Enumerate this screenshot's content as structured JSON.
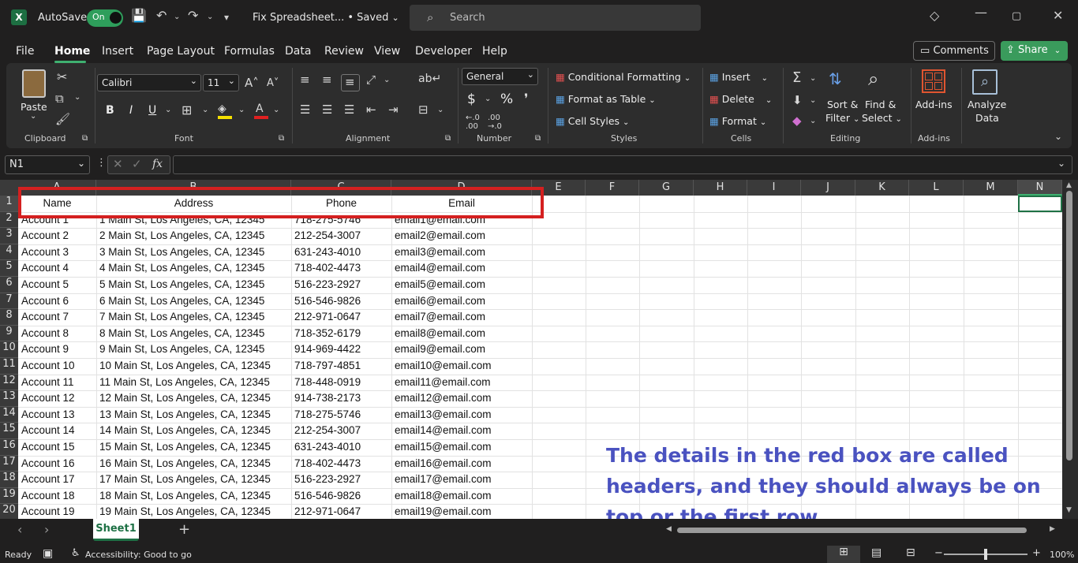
{
  "titlebar": {
    "app_icon": "X",
    "autosave_label": "AutoSave",
    "autosave_state": "On",
    "doc_title": "Fix Spreadsheet... • Saved",
    "search_placeholder": "Search"
  },
  "menu": {
    "tabs": [
      "File",
      "Home",
      "Insert",
      "Page Layout",
      "Formulas",
      "Data",
      "Review",
      "View",
      "Developer",
      "Help"
    ],
    "active": "Home",
    "comments_label": "Comments",
    "share_label": "Share"
  },
  "ribbon": {
    "clipboard": {
      "paste": "Paste",
      "label": "Clipboard"
    },
    "font": {
      "name": "Calibri",
      "size": "11",
      "label": "Font",
      "bold": "B",
      "italic": "I",
      "underline": "U"
    },
    "alignment": {
      "label": "Alignment"
    },
    "number": {
      "format": "General",
      "label": "Number",
      "currency": "$",
      "percent": "%"
    },
    "styles": {
      "conditional": "Conditional Formatting",
      "format_table": "Format as Table",
      "cell_styles": "Cell Styles",
      "label": "Styles"
    },
    "cells": {
      "insert": "Insert",
      "delete": "Delete",
      "format": "Format",
      "label": "Cells"
    },
    "editing": {
      "sort_filter_1": "Sort &",
      "sort_filter_2": "Filter",
      "find_select_1": "Find &",
      "find_select_2": "Select",
      "label": "Editing"
    },
    "addins": {
      "addins": "Add-ins",
      "label": "Add-ins"
    },
    "analyze": {
      "line1": "Analyze",
      "line2": "Data"
    }
  },
  "formula_bar": {
    "name_box": "N1",
    "fx": "fx",
    "value": ""
  },
  "sheet": {
    "columns": [
      "A",
      "B",
      "C",
      "D",
      "E",
      "F",
      "G",
      "H",
      "I",
      "J",
      "K",
      "L",
      "M",
      "N"
    ],
    "headers": [
      "Name",
      "Address",
      "Phone",
      "Email"
    ],
    "rows": [
      [
        "Account 1",
        "1 Main St, Los Angeles, CA, 12345",
        "718-275-5746",
        "email1@email.com"
      ],
      [
        "Account 2",
        "2 Main St, Los Angeles, CA, 12345",
        "212-254-3007",
        "email2@email.com"
      ],
      [
        "Account 3",
        "3 Main St, Los Angeles, CA, 12345",
        "631-243-4010",
        "email3@email.com"
      ],
      [
        "Account 4",
        "4 Main St, Los Angeles, CA, 12345",
        "718-402-4473",
        "email4@email.com"
      ],
      [
        "Account 5",
        "5 Main St, Los Angeles, CA, 12345",
        "516-223-2927",
        "email5@email.com"
      ],
      [
        "Account 6",
        "6 Main St, Los Angeles, CA, 12345",
        "516-546-9826",
        "email6@email.com"
      ],
      [
        "Account 7",
        "7 Main St, Los Angeles, CA, 12345",
        "212-971-0647",
        "email7@email.com"
      ],
      [
        "Account 8",
        "8 Main St, Los Angeles, CA, 12345",
        "718-352-6179",
        "email8@email.com"
      ],
      [
        "Account 9",
        "9 Main St, Los Angeles, CA, 12345",
        "914-969-4422",
        "email9@email.com"
      ],
      [
        "Account 10",
        "10 Main St, Los Angeles, CA, 12345",
        "718-797-4851",
        "email10@email.com"
      ],
      [
        "Account 11",
        "11 Main St, Los Angeles, CA, 12345",
        "718-448-0919",
        "email11@email.com"
      ],
      [
        "Account 12",
        "12 Main St, Los Angeles, CA, 12345",
        "914-738-2173",
        "email12@email.com"
      ],
      [
        "Account 13",
        "13 Main St, Los Angeles, CA, 12345",
        "718-275-5746",
        "email13@email.com"
      ],
      [
        "Account 14",
        "14 Main St, Los Angeles, CA, 12345",
        "212-254-3007",
        "email14@email.com"
      ],
      [
        "Account 15",
        "15 Main St, Los Angeles, CA, 12345",
        "631-243-4010",
        "email15@email.com"
      ],
      [
        "Account 16",
        "16 Main St, Los Angeles, CA, 12345",
        "718-402-4473",
        "email16@email.com"
      ],
      [
        "Account 17",
        "17 Main St, Los Angeles, CA, 12345",
        "516-223-2927",
        "email17@email.com"
      ],
      [
        "Account 18",
        "18 Main St, Los Angeles, CA, 12345",
        "516-546-9826",
        "email18@email.com"
      ],
      [
        "Account 19",
        "19 Main St, Los Angeles, CA, 12345",
        "212-971-0647",
        "email19@email.com"
      ]
    ],
    "annotation": "The details in the red box are called headers, and they should always be on top or the first row.",
    "accent_color": "#d42020",
    "annotation_color": "#4a52c0"
  },
  "sheet_tabs": {
    "active": "Sheet1"
  },
  "status": {
    "ready": "Ready",
    "accessibility": "Accessibility: Good to go",
    "zoom": "100%"
  }
}
